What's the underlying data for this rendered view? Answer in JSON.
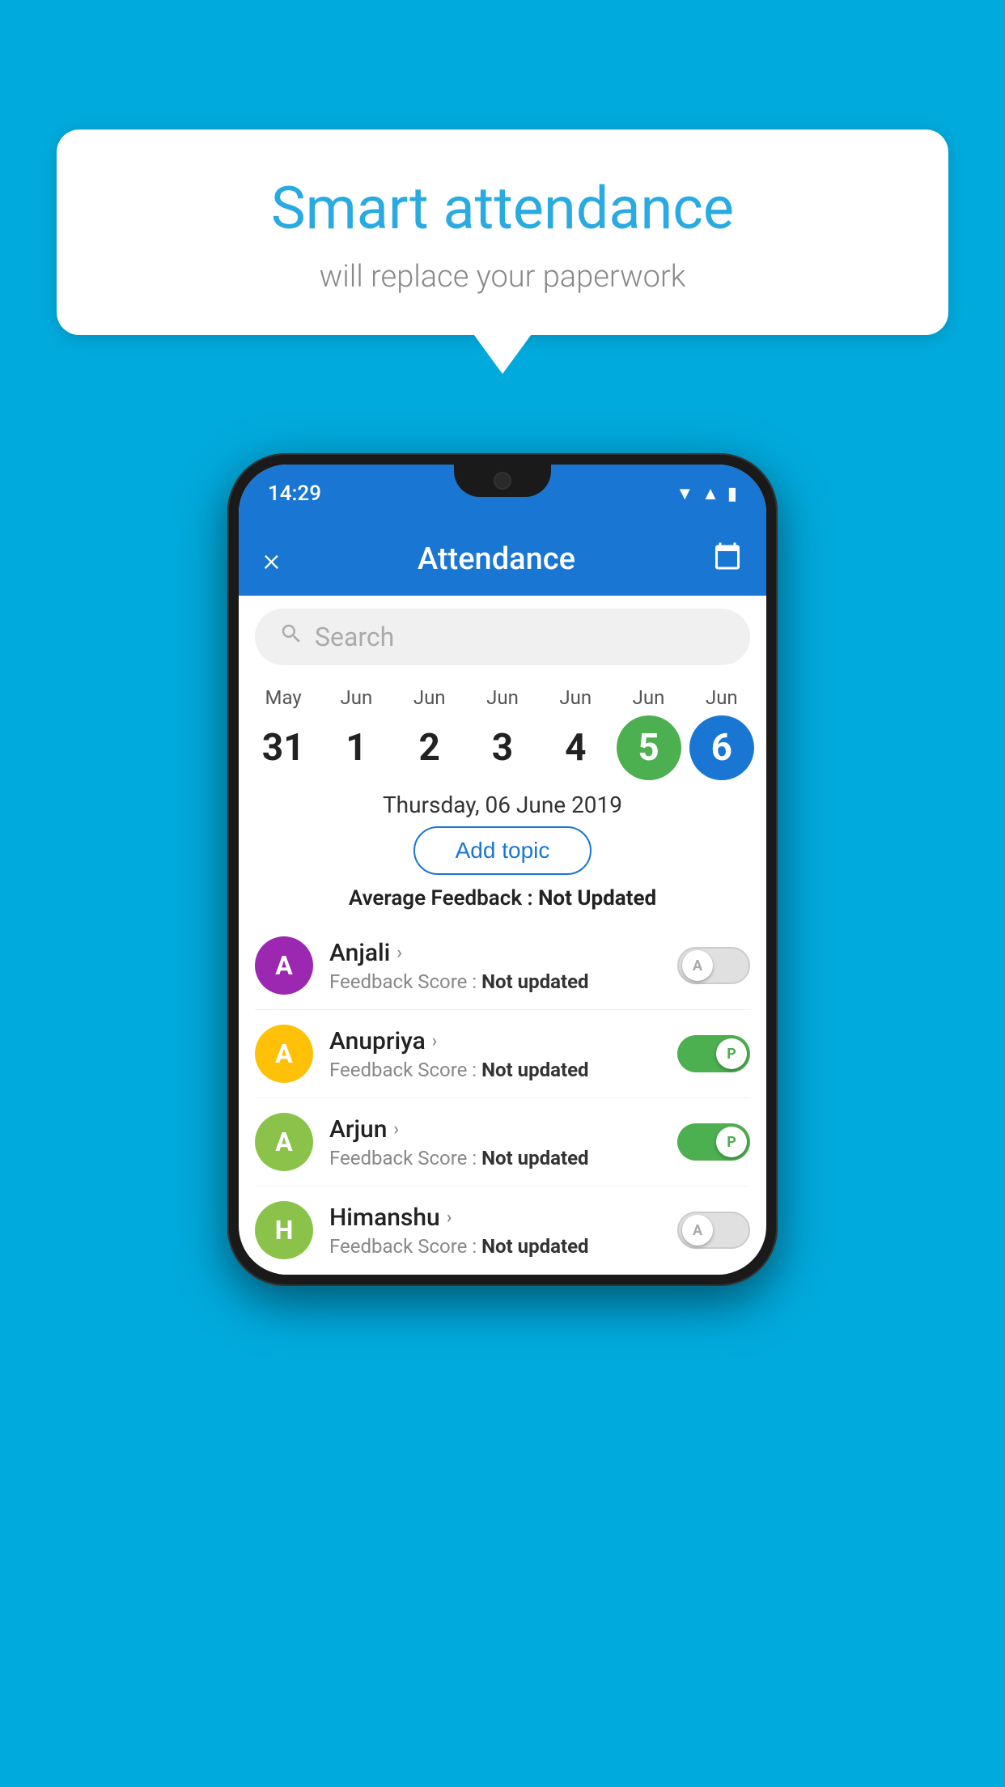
{
  "background": {
    "color": "#00AADD"
  },
  "bubble": {
    "title": "Smart attendance",
    "subtitle": "will replace your paperwork"
  },
  "phone": {
    "status_bar": {
      "time": "14:29",
      "icons": [
        "wifi",
        "signal",
        "battery"
      ]
    },
    "header": {
      "title": "Attendance",
      "close_label": "×",
      "calendar_icon": "📅"
    },
    "search": {
      "placeholder": "Search"
    },
    "calendar": {
      "days": [
        {
          "month": "May",
          "date": "31",
          "state": "normal"
        },
        {
          "month": "Jun",
          "date": "1",
          "state": "normal"
        },
        {
          "month": "Jun",
          "date": "2",
          "state": "normal"
        },
        {
          "month": "Jun",
          "date": "3",
          "state": "normal"
        },
        {
          "month": "Jun",
          "date": "4",
          "state": "normal"
        },
        {
          "month": "Jun",
          "date": "5",
          "state": "today"
        },
        {
          "month": "Jun",
          "date": "6",
          "state": "selected"
        }
      ]
    },
    "selected_date": "Thursday, 06 June 2019",
    "add_topic_label": "Add topic",
    "avg_feedback_label": "Average Feedback :",
    "avg_feedback_value": "Not Updated",
    "students": [
      {
        "name": "Anjali",
        "initial": "A",
        "avatar_color": "#9C27B0",
        "feedback_label": "Feedback Score :",
        "feedback_value": "Not updated",
        "toggle_state": "off",
        "toggle_letter": "A"
      },
      {
        "name": "Anupriya",
        "initial": "A",
        "avatar_color": "#FFC107",
        "feedback_label": "Feedback Score :",
        "feedback_value": "Not updated",
        "toggle_state": "on",
        "toggle_letter": "P"
      },
      {
        "name": "Arjun",
        "initial": "A",
        "avatar_color": "#8BC34A",
        "feedback_label": "Feedback Score :",
        "feedback_value": "Not updated",
        "toggle_state": "on",
        "toggle_letter": "P"
      },
      {
        "name": "Himanshu",
        "initial": "H",
        "avatar_color": "#8BC34A",
        "feedback_label": "Feedback Score :",
        "feedback_value": "Not updated",
        "toggle_state": "off",
        "toggle_letter": "A"
      }
    ]
  }
}
